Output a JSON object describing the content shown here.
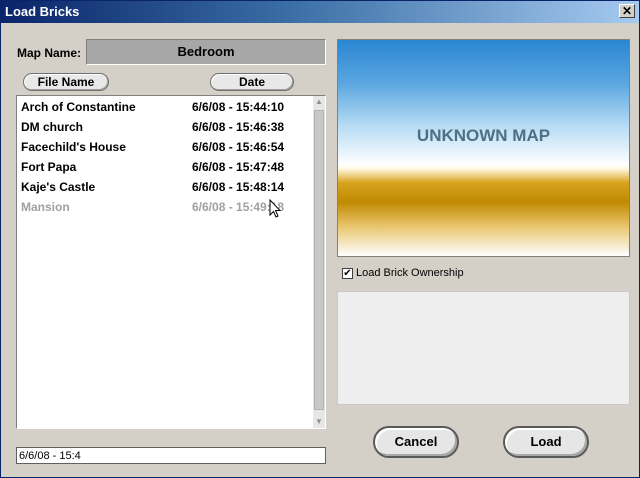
{
  "window": {
    "title": "Load Bricks",
    "close_glyph": "✕"
  },
  "map_name": {
    "label": "Map Name:",
    "value": "Bedroom"
  },
  "columns": {
    "file_name": "File Name",
    "date": "Date"
  },
  "files": [
    {
      "name": "Arch of Constantine",
      "date": "6/6/08 - 15:44:10"
    },
    {
      "name": "DM church",
      "date": "6/6/08 - 15:46:38"
    },
    {
      "name": "Facechild's House",
      "date": "6/6/08 - 15:46:54"
    },
    {
      "name": "Fort Papa",
      "date": "6/6/08 - 15:47:48"
    },
    {
      "name": "Kaje's Castle",
      "date": "6/6/08 - 15:48:14"
    },
    {
      "name": "Mansion",
      "date": "6/6/08 - 15:49:18"
    }
  ],
  "path_input": {
    "value": "6/6/08 - 15:4"
  },
  "preview": {
    "text": "UNKNOWN MAP"
  },
  "ownership": {
    "label": "Load Brick Ownership",
    "checked_glyph": "✔"
  },
  "buttons": {
    "cancel": "Cancel",
    "load": "Load"
  },
  "scrollbar": {
    "up_glyph": "▲",
    "down_glyph": "▼"
  },
  "icons": {
    "cursor": "arrow-cursor-icon"
  }
}
